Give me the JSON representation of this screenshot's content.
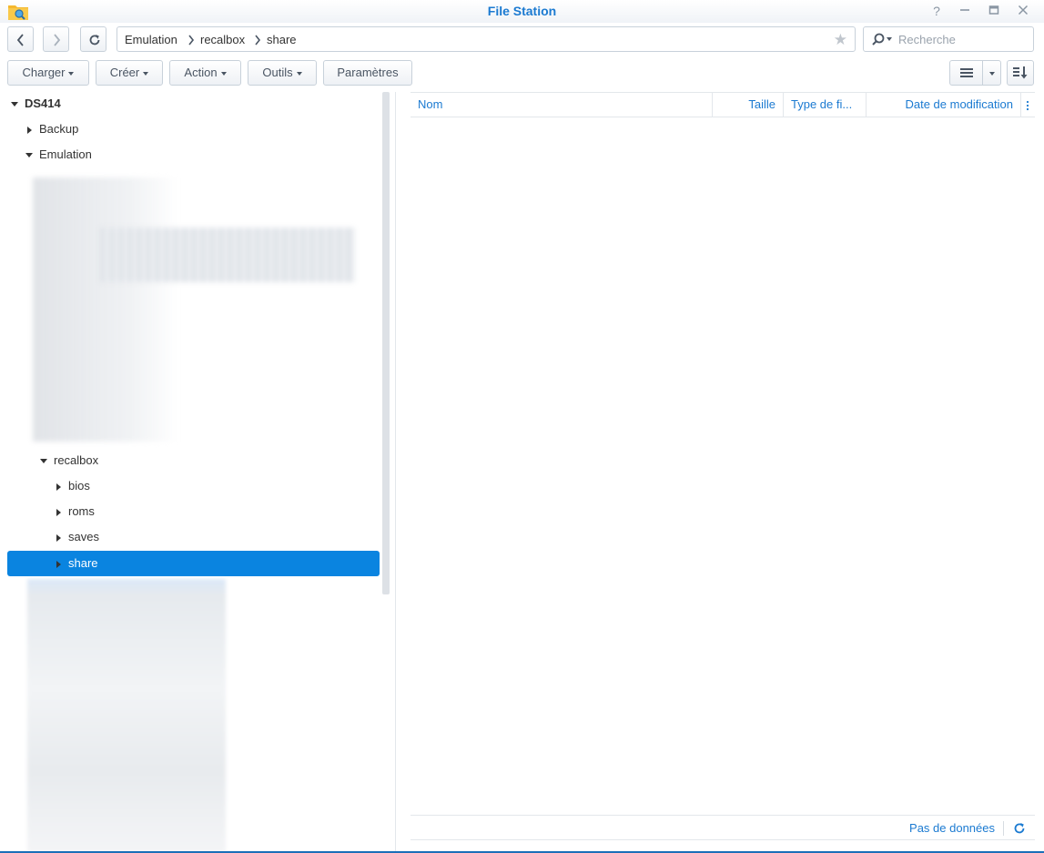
{
  "window": {
    "title": "File Station",
    "controls": [
      "help-icon",
      "minimize-icon",
      "maximize-icon",
      "close-icon"
    ]
  },
  "nav": {
    "path": [
      "Emulation",
      "recalbox",
      "share"
    ],
    "search_placeholder": "Recherche"
  },
  "toolbar": {
    "upload_label": "Charger",
    "create_label": "Créer",
    "action_label": "Action",
    "tools_label": "Outils",
    "settings_label": "Paramètres"
  },
  "tree": {
    "root": "DS414",
    "items": [
      {
        "label": "Backup",
        "expanded": false
      },
      {
        "label": "Emulation",
        "expanded": true
      },
      {
        "label": "recalbox",
        "expanded": true
      },
      {
        "label": "bios",
        "expanded": false
      },
      {
        "label": "roms",
        "expanded": false
      },
      {
        "label": "saves",
        "expanded": false
      },
      {
        "label": "share",
        "expanded": false,
        "selected": true
      }
    ]
  },
  "grid": {
    "columns": [
      "Nom",
      "Taille",
      "Type de fi...",
      "Date de modification"
    ],
    "empty_text": "Pas de données"
  },
  "colors": {
    "accent": "#1b7ad1",
    "selection": "#0a84e0"
  }
}
